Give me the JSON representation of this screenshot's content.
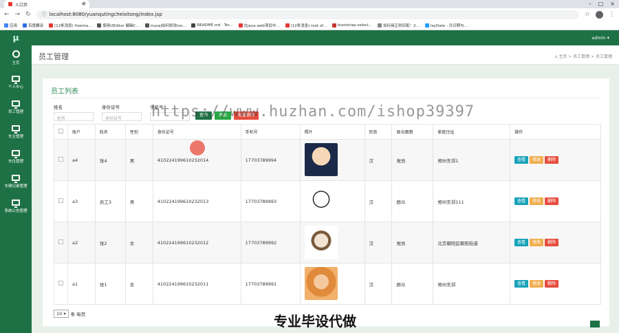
{
  "browser": {
    "tab_title": "入口页",
    "new_tab": "+",
    "url": "localhost:8080/yuanqutingcheixitong/index.jsp",
    "bookmarks": [
      {
        "label": "应用",
        "color": "#4285f4"
      },
      {
        "label": "百度翻译",
        "color": "#2b6de8"
      },
      {
        "label": "(12条消息) freema...",
        "color": "#e53935"
      },
      {
        "label": "使用UEditor 编辑C...",
        "color": "#555555"
      },
      {
        "label": "mysql如何修改loo...",
        "color": "#555555"
      },
      {
        "label": "README.md · Ter...",
        "color": "#444444"
      },
      {
        "label": "在java web项目中...",
        "color": "#e53935"
      },
      {
        "label": "(12条消息) root of...",
        "color": "#e53935"
      },
      {
        "label": "bootstrap-select...",
        "color": "#c0392b"
      },
      {
        "label": "如何用正则匹配：2...",
        "color": "#888888"
      },
      {
        "label": "layDate - 月日期与...",
        "color": "#1e9fff"
      }
    ]
  },
  "app": {
    "logo": "μ",
    "admin": "admin ▾",
    "sidebar": [
      {
        "label": "主页",
        "icon": "dashboard-icon"
      },
      {
        "label": "个人中心",
        "icon": "monitor-icon"
      },
      {
        "label": "员工管理",
        "icon": "monitor-icon"
      },
      {
        "label": "车主管理",
        "icon": "monitor-icon"
      },
      {
        "label": "车位管理",
        "icon": "monitor-icon"
      },
      {
        "label": "车辆记录管理",
        "icon": "monitor-icon"
      },
      {
        "label": "系统公告管理",
        "icon": "monitor-icon"
      }
    ],
    "page_title": "员工管理",
    "breadcrumb": "⌂ 主页  >  员工管理  >  员工管理",
    "panel_title": "员工列表",
    "filters": [
      {
        "label": "姓名",
        "placeholder": "姓名"
      },
      {
        "label": "身份证号",
        "placeholder": "身份证号"
      },
      {
        "label": "手机号",
        "placeholder": ""
      }
    ],
    "filter_buttons": [
      "查询",
      "添加",
      "批量删除"
    ],
    "columns": [
      "",
      "账户",
      "姓名",
      "性别",
      "身份证号",
      "手机号",
      "照片",
      "民族",
      "政治面貌",
      "家庭住址",
      "操作"
    ],
    "rows": [
      {
        "account": "a4",
        "name": "张4",
        "gender": "男",
        "idcard": "410224199610232014",
        "phone": "17703789994",
        "ethnic": "汉",
        "political": "党员",
        "address": "郑州东郊1"
      },
      {
        "account": "a3",
        "name": "员工3",
        "gender": "男",
        "idcard": "410224199610232013",
        "phone": "17703789993",
        "ethnic": "汉",
        "political": "群众",
        "address": "郑州东郊111"
      },
      {
        "account": "a2",
        "name": "张2",
        "gender": "女",
        "idcard": "410224199610232012",
        "phone": "17703789992",
        "ethnic": "汉",
        "political": "党员",
        "address": "北京朝阳区朝阳街道"
      },
      {
        "account": "a1",
        "name": "张1",
        "gender": "女",
        "idcard": "410224199610232011",
        "phone": "17703789991",
        "ethnic": "汉",
        "political": "群众",
        "address": "郑州东郊"
      }
    ],
    "ops": {
      "view": "查看",
      "edit": "修改",
      "delete": "删除"
    },
    "pager": {
      "size": "10",
      "suffix": "条 每页"
    }
  },
  "overlay": {
    "watermark": "https://www.huzhan.com/ishop39397",
    "badge": "专业毕设代做"
  }
}
